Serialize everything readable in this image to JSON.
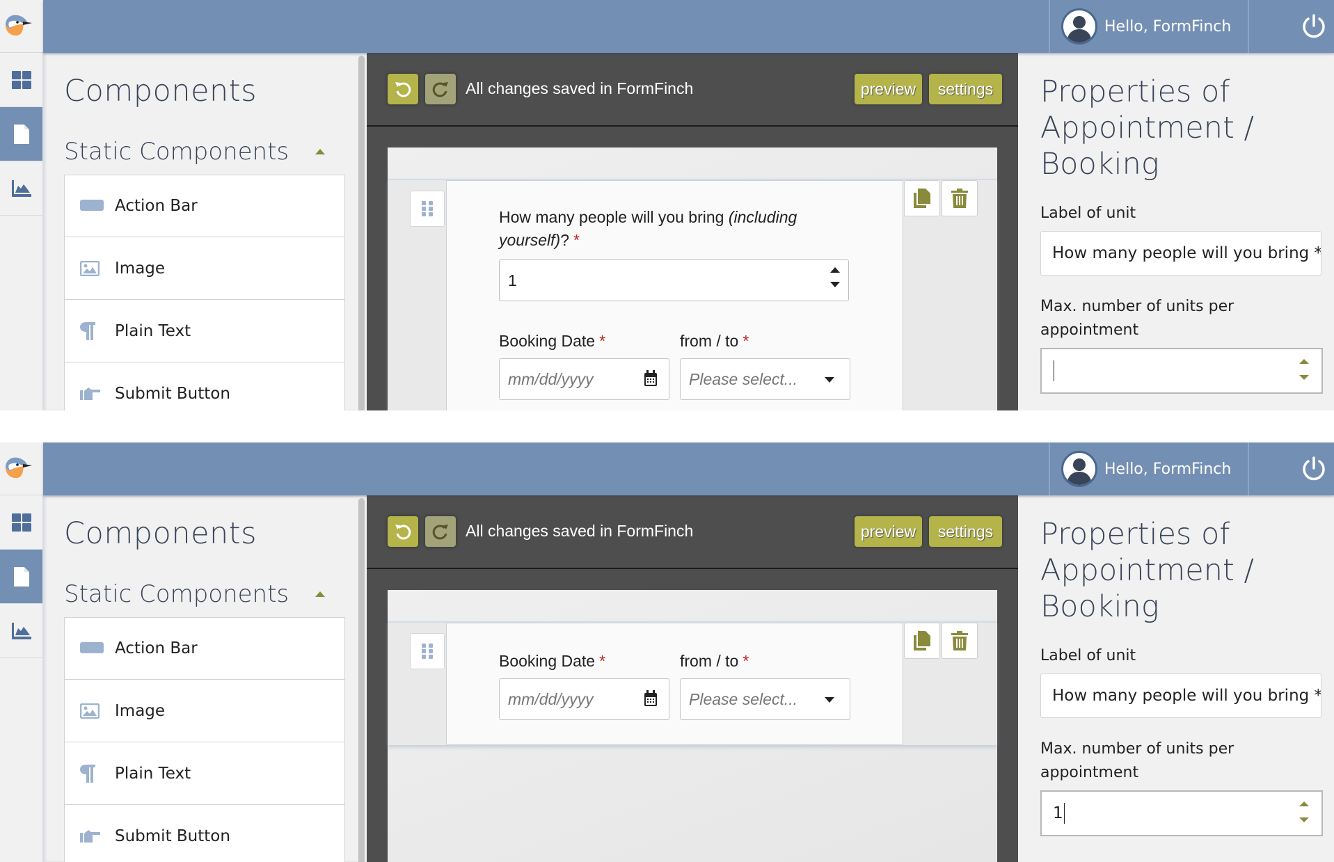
{
  "header": {
    "greeting": "Hello, FormFinch",
    "icons": {
      "logo": "finch-bird-logo",
      "avatar": "user-avatar-icon",
      "power": "power-icon"
    }
  },
  "rail": {
    "items": [
      {
        "name": "dashboard",
        "icon": "grid-icon",
        "active": false
      },
      {
        "name": "forms",
        "icon": "document-icon",
        "active": true
      },
      {
        "name": "analytics",
        "icon": "area-chart-icon",
        "active": false
      }
    ]
  },
  "components": {
    "title": "Components",
    "section": "Static Components",
    "items": [
      {
        "label": "Action Bar",
        "icon": "action-bar-icon"
      },
      {
        "label": "Image",
        "icon": "image-icon"
      },
      {
        "label": "Plain Text",
        "icon": "paragraph-icon"
      },
      {
        "label": "Submit Button",
        "icon": "pointing-hand-icon"
      }
    ]
  },
  "toolbar": {
    "status": "All changes saved in FormFinch",
    "preview_label": "preview",
    "settings_label": "settings"
  },
  "form": {
    "people_label_main": "How many people will you bring ",
    "people_label_italic": "(including yourself)",
    "people_label_suffix": "?",
    "people_value": "1",
    "required_mark": "*",
    "booking_date_label": "Booking Date",
    "booking_date_placeholder": "mm/dd/yyyy",
    "from_to_label": "from / to",
    "from_to_placeholder": "Please select..."
  },
  "properties": {
    "title": "Properties of Appointment / Booking",
    "label_of_unit_label": "Label of unit",
    "label_of_unit_value": "How many people will you bring *",
    "max_units_label": "Max. number of units per appointment"
  },
  "screens": {
    "before": {
      "max_units_value": ""
    },
    "after": {
      "max_units_value": "1"
    }
  },
  "colors": {
    "topbar": "#748fb4",
    "accent_olive": "#b4b44a",
    "icon_olive": "#8a8a3c",
    "canvas_dark": "#4e4e4e",
    "required": "#c42020"
  }
}
